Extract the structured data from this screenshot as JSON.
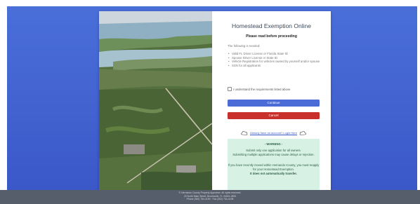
{
  "page": {
    "title": "Homestead Exemption Online",
    "subtitle": "Please read before proceeding"
  },
  "requirements": {
    "intro": "The following is needed:",
    "items": [
      "Valid FL Driver License or Florida State ID",
      "Spouse Driver License or State ID",
      "Vehicle Registration for vehicles owned by yourself and/or spouse",
      "SSN for all applicants"
    ]
  },
  "acknowledge": {
    "label": "I understand the requirements listed above",
    "checked": false
  },
  "actions": {
    "continue_label": "Continue",
    "cancel_label": "Cancel",
    "account_link": "Already have an account? Login Here"
  },
  "warning": {
    "heading": "- WARNING -",
    "line1": "Submit only one application for all owners.",
    "line2": "Submitting multiple applications may cause delays or rejection.",
    "line3": "If you have recently moved within Hernando County, you must reapply for your Homestead Exemption.",
    "line4": "It does not automatically transfer."
  },
  "footer": {
    "line1": "© Hernando County Property Appraiser. All rights reserved.",
    "line2": "20 North Main Street, Brooksville, FL 34601-2893",
    "line3": "Phone (352) 754-4190 · Fax (352) 754-4198"
  },
  "colors": {
    "background": "#3a57c8",
    "continue": "#4b6cd6",
    "cancel": "#c9302c",
    "warning_bg": "#d7f2e4"
  }
}
